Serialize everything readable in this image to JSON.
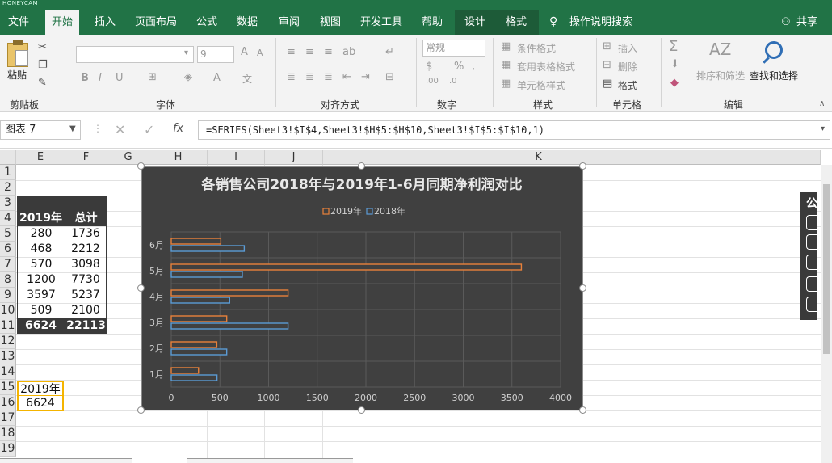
{
  "watermark": "HONEYCAM",
  "tabs": [
    "文件",
    "开始",
    "插入",
    "页面布局",
    "公式",
    "数据",
    "审阅",
    "视图",
    "开发工具",
    "帮助",
    "设计",
    "格式"
  ],
  "search_label": "操作说明搜索",
  "share_label": "共享",
  "ribbon": {
    "paste": "粘贴",
    "font_size": "9",
    "number_format": "常规",
    "cond_format": "条件格式",
    "table_format": "套用表格格式",
    "cell_style": "单元格样式",
    "insert": "插入",
    "delete": "删除",
    "format": "格式",
    "sort": "排序和筛选",
    "find": "查找和选择",
    "groups": [
      "剪贴板",
      "字体",
      "对齐方式",
      "数字",
      "样式",
      "单元格",
      "编辑"
    ]
  },
  "formula_bar": {
    "name_box": "图表 7",
    "formula": "=SERIES(Sheet3!$I$4,Sheet3!$H$5:$H$10,Sheet3!$I$5:$I$10,1)"
  },
  "columns": [
    "E",
    "F",
    "G",
    "H",
    "I",
    "J",
    "K"
  ],
  "rows": [
    "1",
    "2",
    "3",
    "4",
    "5",
    "6",
    "7",
    "8",
    "9",
    "10",
    "11",
    "12",
    "13",
    "14",
    "15",
    "16",
    "17",
    "18",
    "19"
  ],
  "table": {
    "header": [
      "2019年",
      "总计"
    ],
    "rows": [
      [
        "280",
        "1736"
      ],
      [
        "468",
        "2212"
      ],
      [
        "570",
        "3098"
      ],
      [
        "1200",
        "7730"
      ],
      [
        "3597",
        "5237"
      ],
      [
        "509",
        "2100"
      ]
    ],
    "total": [
      "6624",
      "22113"
    ]
  },
  "selected_cells": [
    "2019年",
    "6624"
  ],
  "side_panel_char": "公",
  "chart_data": {
    "type": "bar",
    "orientation": "horizontal",
    "title": "各销售公司2018年与2019年1-6月同期净利润对比",
    "categories": [
      "1月",
      "2月",
      "3月",
      "4月",
      "5月",
      "6月"
    ],
    "series": [
      {
        "name": "2019年",
        "color": "#e8813a",
        "values": [
          280,
          468,
          570,
          1200,
          3597,
          509
        ]
      },
      {
        "name": "2018年",
        "color": "#5b9bd5",
        "values": [
          470,
          570,
          1200,
          600,
          730,
          750
        ]
      }
    ],
    "xlim": [
      0,
      4000
    ],
    "xticks": [
      "0",
      "500",
      "1000",
      "1500",
      "2000",
      "2500",
      "3000",
      "3500",
      "4000"
    ],
    "legend_position": "top",
    "grid": true
  }
}
